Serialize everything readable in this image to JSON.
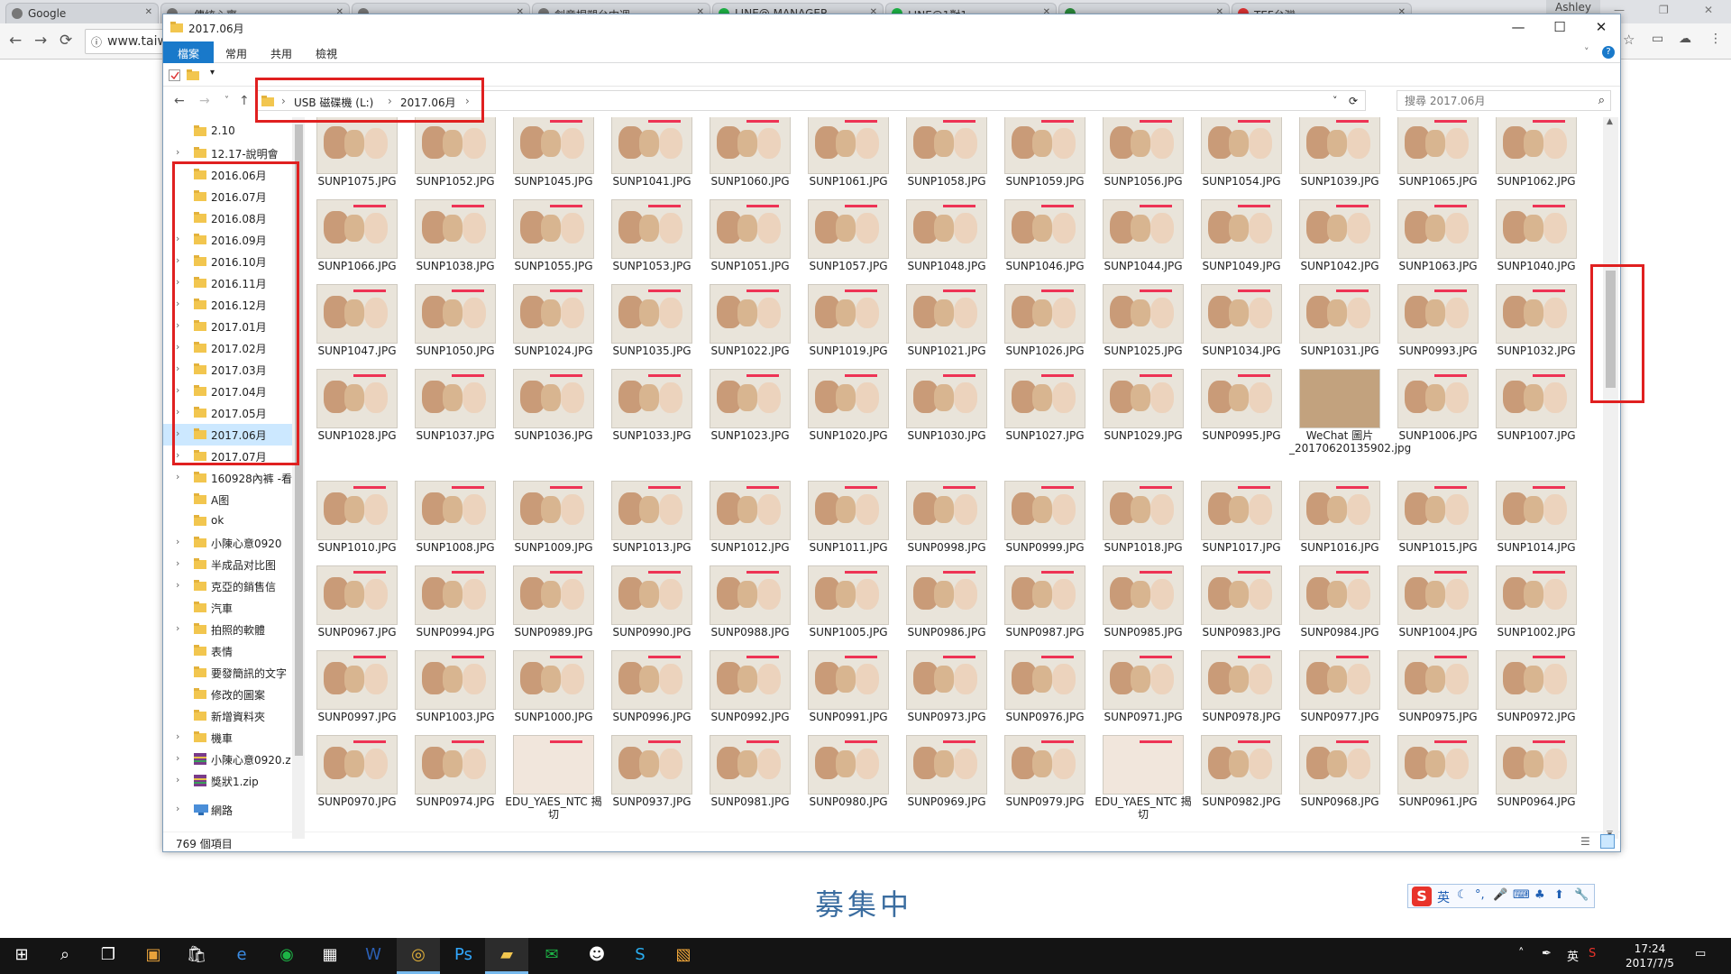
{
  "browser": {
    "tabs": [
      "Google",
      "…傳統心齋",
      "…",
      "創意捏塑台中週…",
      "LINE@ MANAGER",
      "LINE@1對1…",
      "…",
      "TEF台灣…"
    ],
    "user": "Ashley",
    "url": "www.taiw"
  },
  "window": {
    "title": "2017.06月",
    "min": "—",
    "max": "☐",
    "close": "✕"
  },
  "ribbon": {
    "tabs": [
      "檔案",
      "常用",
      "共用",
      "檢視"
    ]
  },
  "address": {
    "crumbs": [
      "USB 磁碟機 (L:)",
      "2017.06月"
    ],
    "separator": "›",
    "search_placeholder": "搜尋 2017.06月",
    "back": "←",
    "forward": "→",
    "recent": "˅",
    "up": "↑",
    "dropdown": "˅",
    "refresh": "⟳",
    "search_icon": "⌕"
  },
  "navpane": {
    "items": [
      {
        "label": "2.10",
        "expand": ""
      },
      {
        "label": "12.17-說明會",
        "expand": "›"
      },
      {
        "label": "2016.06月",
        "expand": ""
      },
      {
        "label": "2016.07月",
        "expand": ""
      },
      {
        "label": "2016.08月",
        "expand": ""
      },
      {
        "label": "2016.09月",
        "expand": "›"
      },
      {
        "label": "2016.10月",
        "expand": "›"
      },
      {
        "label": "2016.11月",
        "expand": "›"
      },
      {
        "label": "2016.12月",
        "expand": "›"
      },
      {
        "label": "2017.01月",
        "expand": "›"
      },
      {
        "label": "2017.02月",
        "expand": "›"
      },
      {
        "label": "2017.03月",
        "expand": "›"
      },
      {
        "label": "2017.04月",
        "expand": "›"
      },
      {
        "label": "2017.05月",
        "expand": "›"
      },
      {
        "label": "2017.06月",
        "expand": "›",
        "selected": true
      },
      {
        "label": "2017.07月",
        "expand": "›"
      },
      {
        "label": "160928內裤 -看",
        "expand": "›"
      },
      {
        "label": "A图",
        "expand": ""
      },
      {
        "label": "ok",
        "expand": ""
      },
      {
        "label": "小陳心意0920",
        "expand": "›"
      },
      {
        "label": "半成品对比图",
        "expand": "›"
      },
      {
        "label": "克亞的銷售信",
        "expand": "›"
      },
      {
        "label": "汽車",
        "expand": ""
      },
      {
        "label": "拍照的軟體",
        "expand": "›"
      },
      {
        "label": "表情",
        "expand": ""
      },
      {
        "label": "要發簡訊的文字",
        "expand": ""
      },
      {
        "label": "修改的圖案",
        "expand": ""
      },
      {
        "label": "新增資料夾",
        "expand": ""
      },
      {
        "label": "機車",
        "expand": "›"
      },
      {
        "label": "小陳心意0920.z",
        "expand": "›",
        "type": "zip"
      },
      {
        "label": "獎狀1.zip",
        "expand": "›",
        "type": "zip"
      },
      {
        "label": "網路",
        "expand": "›",
        "type": "network"
      }
    ]
  },
  "files": [
    "SUNP1075.JPG",
    "SUNP1052.JPG",
    "SUNP1045.JPG",
    "SUNP1041.JPG",
    "SUNP1060.JPG",
    "SUNP1061.JPG",
    "SUNP1058.JPG",
    "SUNP1059.JPG",
    "SUNP1056.JPG",
    "SUNP1054.JPG",
    "SUNP1039.JPG",
    "SUNP1065.JPG",
    "SUNP1062.JPG",
    "SUNP1066.JPG",
    "SUNP1038.JPG",
    "SUNP1055.JPG",
    "SUNP1053.JPG",
    "SUNP1051.JPG",
    "SUNP1057.JPG",
    "SUNP1048.JPG",
    "SUNP1046.JPG",
    "SUNP1044.JPG",
    "SUNP1049.JPG",
    "SUNP1042.JPG",
    "SUNP1063.JPG",
    "SUNP1040.JPG",
    "SUNP1047.JPG",
    "SUNP1050.JPG",
    "SUNP1024.JPG",
    "SUNP1035.JPG",
    "SUNP1022.JPG",
    "SUNP1019.JPG",
    "SUNP1021.JPG",
    "SUNP1026.JPG",
    "SUNP1025.JPG",
    "SUNP1034.JPG",
    "SUNP1031.JPG",
    "SUNP0993.JPG",
    "SUNP1032.JPG",
    "SUNP1028.JPG",
    "SUNP1037.JPG",
    "SUNP1036.JPG",
    "SUNP1033.JPG",
    "SUNP1023.JPG",
    "SUNP1020.JPG",
    "SUNP1030.JPG",
    "SUNP1027.JPG",
    "SUNP1029.JPG",
    "SUNP0995.JPG",
    "WeChat 圖片_20170620135902.jpg",
    "SUNP1006.JPG",
    "SUNP1007.JPG",
    "SUNP1010.JPG",
    "SUNP1008.JPG",
    "SUNP1009.JPG",
    "SUNP1013.JPG",
    "SUNP1012.JPG",
    "SUNP1011.JPG",
    "SUNP0998.JPG",
    "SUNP0999.JPG",
    "SUNP1018.JPG",
    "SUNP1017.JPG",
    "SUNP1016.JPG",
    "SUNP1015.JPG",
    "SUNP1014.JPG",
    "SUNP0967.JPG",
    "SUNP0994.JPG",
    "SUNP0989.JPG",
    "SUNP0990.JPG",
    "SUNP0988.JPG",
    "SUNP1005.JPG",
    "SUNP0986.JPG",
    "SUNP0987.JPG",
    "SUNP0985.JPG",
    "SUNP0983.JPG",
    "SUNP0984.JPG",
    "SUNP1004.JPG",
    "SUNP1002.JPG",
    "SUNP0997.JPG",
    "SUNP1003.JPG",
    "SUNP1000.JPG",
    "SUNP0996.JPG",
    "SUNP0992.JPG",
    "SUNP0991.JPG",
    "SUNP0973.JPG",
    "SUNP0976.JPG",
    "SUNP0971.JPG",
    "SUNP0978.JPG",
    "SUNP0977.JPG",
    "SUNP0975.JPG",
    "SUNP0972.JPG",
    "SUNP0970.JPG",
    "SUNP0974.JPG",
    "EDU_YAES_NTC 揭切",
    "SUNP0937.JPG",
    "SUNP0981.JPG",
    "SUNP0980.JPG",
    "SUNP0969.JPG",
    "SUNP0979.JPG",
    "EDU_YAES_NTC 揭切",
    "SUNP0982.JPG",
    "SUNP0968.JPG",
    "SUNP0961.JPG",
    "SUNP0964.JPG"
  ],
  "status": {
    "item_count": "769 個項目"
  },
  "caption": "募集中",
  "ime": {
    "mode": "英"
  },
  "taskbar": {
    "time": "17:24",
    "date": "2017/7/5",
    "ime": "英"
  },
  "colors": {
    "accent": "#1979ca",
    "highlight": "#e02020",
    "selection": "#cce8ff"
  }
}
